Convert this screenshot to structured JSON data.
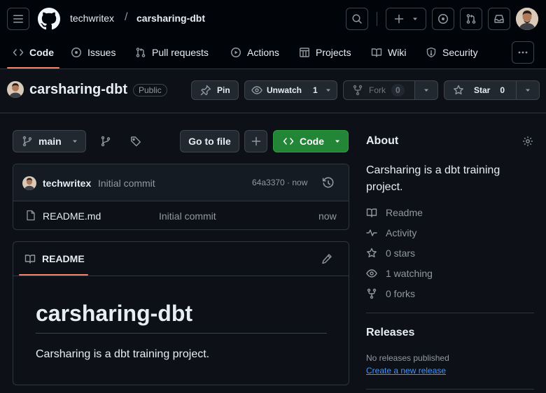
{
  "header": {
    "owner": "techwritex",
    "separator": "/",
    "repo": "carsharing-dbt"
  },
  "tabs": [
    {
      "label": "Code"
    },
    {
      "label": "Issues"
    },
    {
      "label": "Pull requests"
    },
    {
      "label": "Actions"
    },
    {
      "label": "Projects"
    },
    {
      "label": "Wiki"
    },
    {
      "label": "Security"
    }
  ],
  "repo_title": {
    "name": "carsharing-dbt",
    "visibility": "Public",
    "pin_label": "Pin",
    "unwatch_label": "Unwatch",
    "watch_count": "1",
    "fork_label": "Fork",
    "fork_count": "0",
    "star_label": "Star",
    "star_count": "0"
  },
  "toolbar": {
    "branch": "main",
    "go_to_file": "Go to file",
    "code_label": "Code"
  },
  "commit": {
    "author": "techwritex",
    "message": "Initial commit",
    "hash_time": "64a3370 · now"
  },
  "files": [
    {
      "name": "README.md",
      "message": "Initial commit",
      "time": "now"
    }
  ],
  "readme": {
    "tab_label": "README",
    "heading": "carsharing-dbt",
    "body": "Carsharing is a dbt training project."
  },
  "about": {
    "title": "About",
    "description": "Carsharing is a dbt training project.",
    "items": [
      {
        "label": "Readme",
        "icon": "book-icon"
      },
      {
        "label": "Activity",
        "icon": "pulse-icon"
      },
      {
        "label": "0 stars",
        "icon": "star-icon"
      },
      {
        "label": "1 watching",
        "icon": "eye-icon"
      },
      {
        "label": "0 forks",
        "icon": "fork-icon"
      }
    ]
  },
  "releases": {
    "title": "Releases",
    "none_text": "No releases published",
    "create_link": "Create a new release"
  },
  "colors": {
    "accent_tab": "#f78166",
    "code_button": "#238636",
    "link": "#4493f8",
    "background": "#0d1117",
    "header_bg": "#010409"
  }
}
